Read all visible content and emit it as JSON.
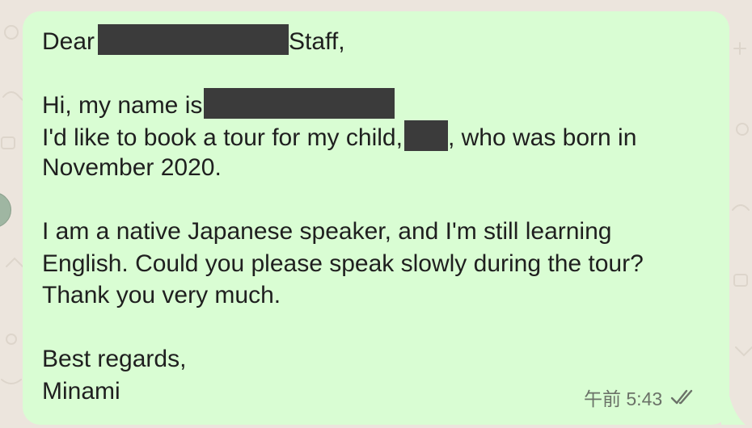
{
  "message": {
    "greeting_prefix": "Dear",
    "greeting_suffix": "Staff,",
    "intro": "Hi, my name is",
    "booking_prefix": "I'd like to book a tour for my child,",
    "booking_suffix": ", who was born in",
    "booking_end": "November 2020.",
    "para2_line1": "I am a native Japanese speaker, and I'm still learning",
    "para2_line2": "English. Could you please speak slowly during the tour?",
    "para2_line3": "Thank you very much.",
    "closing": "Best regards,",
    "signature": "Minami",
    "timestamp": "午前 5:43",
    "status_icon": "double-check-icon"
  },
  "colors": {
    "bubble": "#d9fdd3",
    "background": "#ece5dd",
    "redaction": "#3b3b3b",
    "meta_text": "#6b7268"
  }
}
